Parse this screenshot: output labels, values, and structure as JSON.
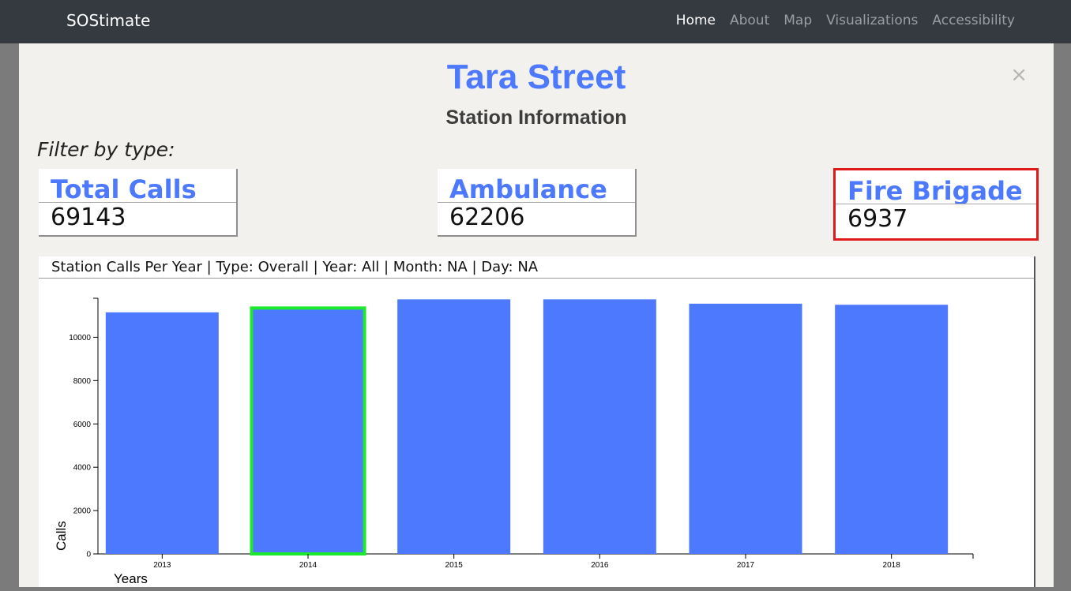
{
  "navbar": {
    "brand": "SOStimate",
    "links": [
      {
        "label": "Home",
        "active": true
      },
      {
        "label": "About",
        "active": false
      },
      {
        "label": "Map",
        "active": false
      },
      {
        "label": "Visualizations",
        "active": false
      },
      {
        "label": "Accessibility",
        "active": false
      }
    ]
  },
  "modal": {
    "close_label": "×",
    "title": "Tara Street",
    "subtitle": "Station Information",
    "filter_label": "Filter by type:"
  },
  "cards": {
    "total": {
      "title": "Total Calls",
      "value": "69143"
    },
    "ambulance": {
      "title": "Ambulance",
      "value": "62206"
    },
    "fire": {
      "title": "Fire Brigade",
      "value": "6937"
    }
  },
  "colors": {
    "accent": "#4d79ff",
    "selected_outline": "#1bea2c",
    "card_highlight": "#e01a1a"
  },
  "chart_header": "Station Calls Per Year | Type: Overall | Year: All | Month: NA | Day: NA",
  "chart_data": {
    "type": "bar",
    "categories": [
      "2013",
      "2014",
      "2015",
      "2016",
      "2017",
      "2018"
    ],
    "values": [
      11150,
      11350,
      11750,
      11750,
      11550,
      11500
    ],
    "selected_category": "2014",
    "ylim": [
      0,
      11800
    ],
    "yticks": [
      0,
      2000,
      4000,
      6000,
      8000,
      10000
    ],
    "xlabel": "Years",
    "ylabel": "Calls",
    "grid": false,
    "legend": "none"
  }
}
